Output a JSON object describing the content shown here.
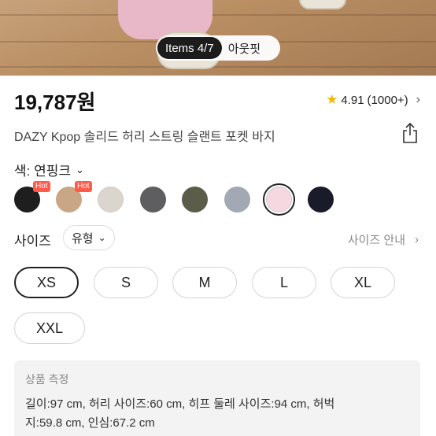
{
  "hero": {
    "active_tab": "Items 4/7",
    "other_tab": "아웃핏"
  },
  "product": {
    "price": "19,787원",
    "rating": "4.91",
    "review_count": "(1000+)",
    "title": "DAZY Kpop 솔리드 허리 스트링 슬랜트 포켓 바지"
  },
  "color": {
    "label": "색: 연핑크",
    "hot_badge": "Hot",
    "swatches": [
      {
        "hex": "#1e1e1e",
        "hot": true
      },
      {
        "hex": "#c9a786",
        "hot": true
      },
      {
        "hex": "#dad6cd",
        "hot": false
      },
      {
        "hex": "#5e5e60",
        "hot": false
      },
      {
        "hex": "#5b5d4a",
        "hot": false
      },
      {
        "hex": "#a3a8b5",
        "hot": false
      },
      {
        "hex": "#f6d8e0",
        "hot": false,
        "selected": true
      },
      {
        "hex": "#1a1b2a",
        "hot": false
      }
    ]
  },
  "size": {
    "label": "사이즈",
    "type_label": "유형",
    "guide_label": "사이즈 안내",
    "options": [
      "XS",
      "S",
      "M",
      "L",
      "XL",
      "XXL"
    ],
    "selected": "XS"
  },
  "measurement": {
    "title": "상품 측정",
    "line1": "길이:97 cm, 허리 사이즈:60 cm, 히프 둘레 사이즈:94 cm, 허벅",
    "line2": "지:59.8 cm, 인심:67.2 cm"
  },
  "colors": {
    "star": "#f5b800",
    "hot_badge": "#ff5a4a"
  }
}
